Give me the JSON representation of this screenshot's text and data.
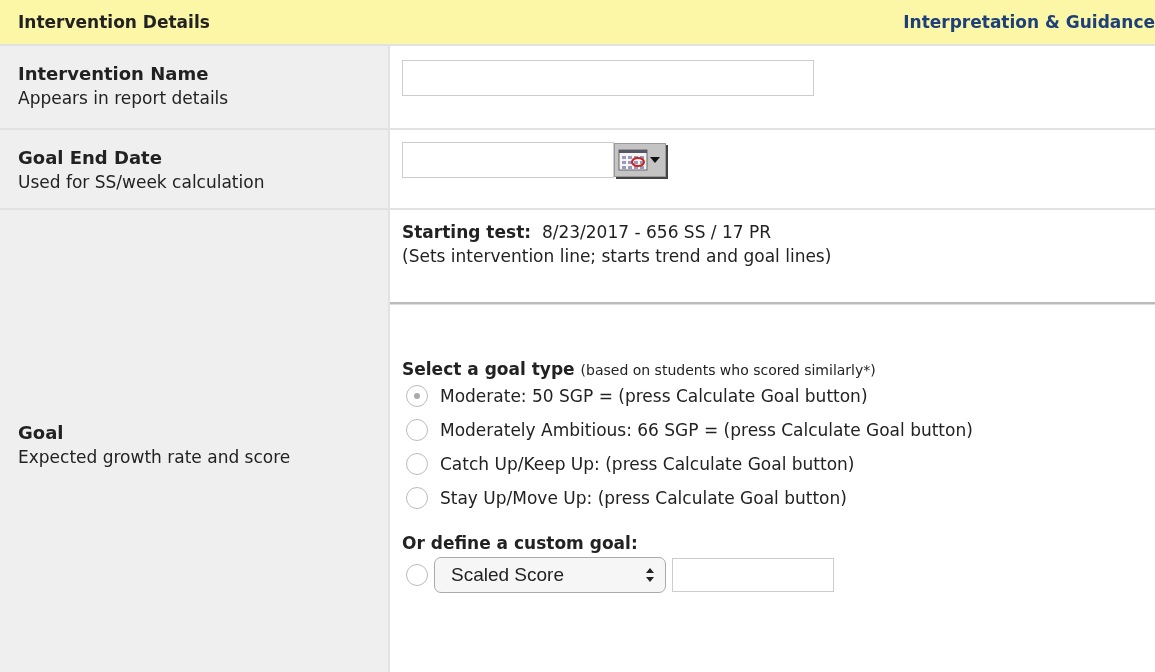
{
  "header": {
    "title": "Intervention Details",
    "link": "Interpretation & Guidance"
  },
  "rows": [
    {
      "kind": "text",
      "label": "Intervention Name",
      "hint": "Appears in report details"
    },
    {
      "kind": "date",
      "label": "Goal End Date",
      "hint": "Used for SS/week calculation"
    },
    {
      "kind": "goal",
      "label": "Goal",
      "hint": "Expected growth rate and score"
    }
  ],
  "goal": {
    "starting_label": "Starting test:",
    "starting_value": "8/23/2017 - 656 SS / 17 PR",
    "starting_note": "(Sets intervention line; starts trend and goal lines)",
    "type_heading": "Select a goal type",
    "type_note": "(based on students who scored similarly*)",
    "options": [
      {
        "label": "Moderate: 50 SGP = (press Calculate Goal button)",
        "selected": true
      },
      {
        "label": "Moderately Ambitious: 66 SGP = (press Calculate Goal button)",
        "selected": false
      },
      {
        "label": "Catch Up/Keep Up: (press Calculate Goal button)",
        "selected": false
      },
      {
        "label": "Stay Up/Move Up: (press Calculate Goal button)",
        "selected": false
      }
    ],
    "custom_heading": "Or define a custom goal:",
    "custom_selected": false,
    "custom_select": "Scaled Score"
  }
}
